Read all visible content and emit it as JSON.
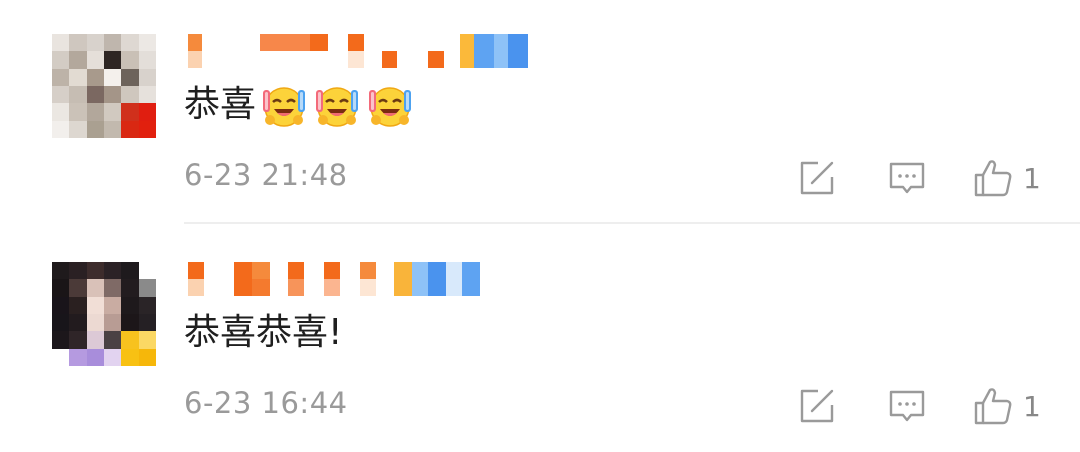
{
  "comments": [
    {
      "text": "恭喜",
      "emoji": [
        "laugh-crying-emoji",
        "laugh-crying-emoji",
        "laugh-crying-emoji"
      ],
      "timestamp": "6-23 21:48",
      "like_count": "1"
    },
    {
      "text": "恭喜恭喜!",
      "emoji": [],
      "timestamp": "6-23 16:44",
      "like_count": "1"
    }
  ],
  "icons": {
    "share": "share-icon",
    "reply": "comment-icon",
    "like": "thumbs-up-icon"
  },
  "colors": {
    "timestamp": "#9a9a9a",
    "icon": "#9a9a9a",
    "divider": "#eeeeee",
    "username_mosaic": "#f57c2a"
  }
}
